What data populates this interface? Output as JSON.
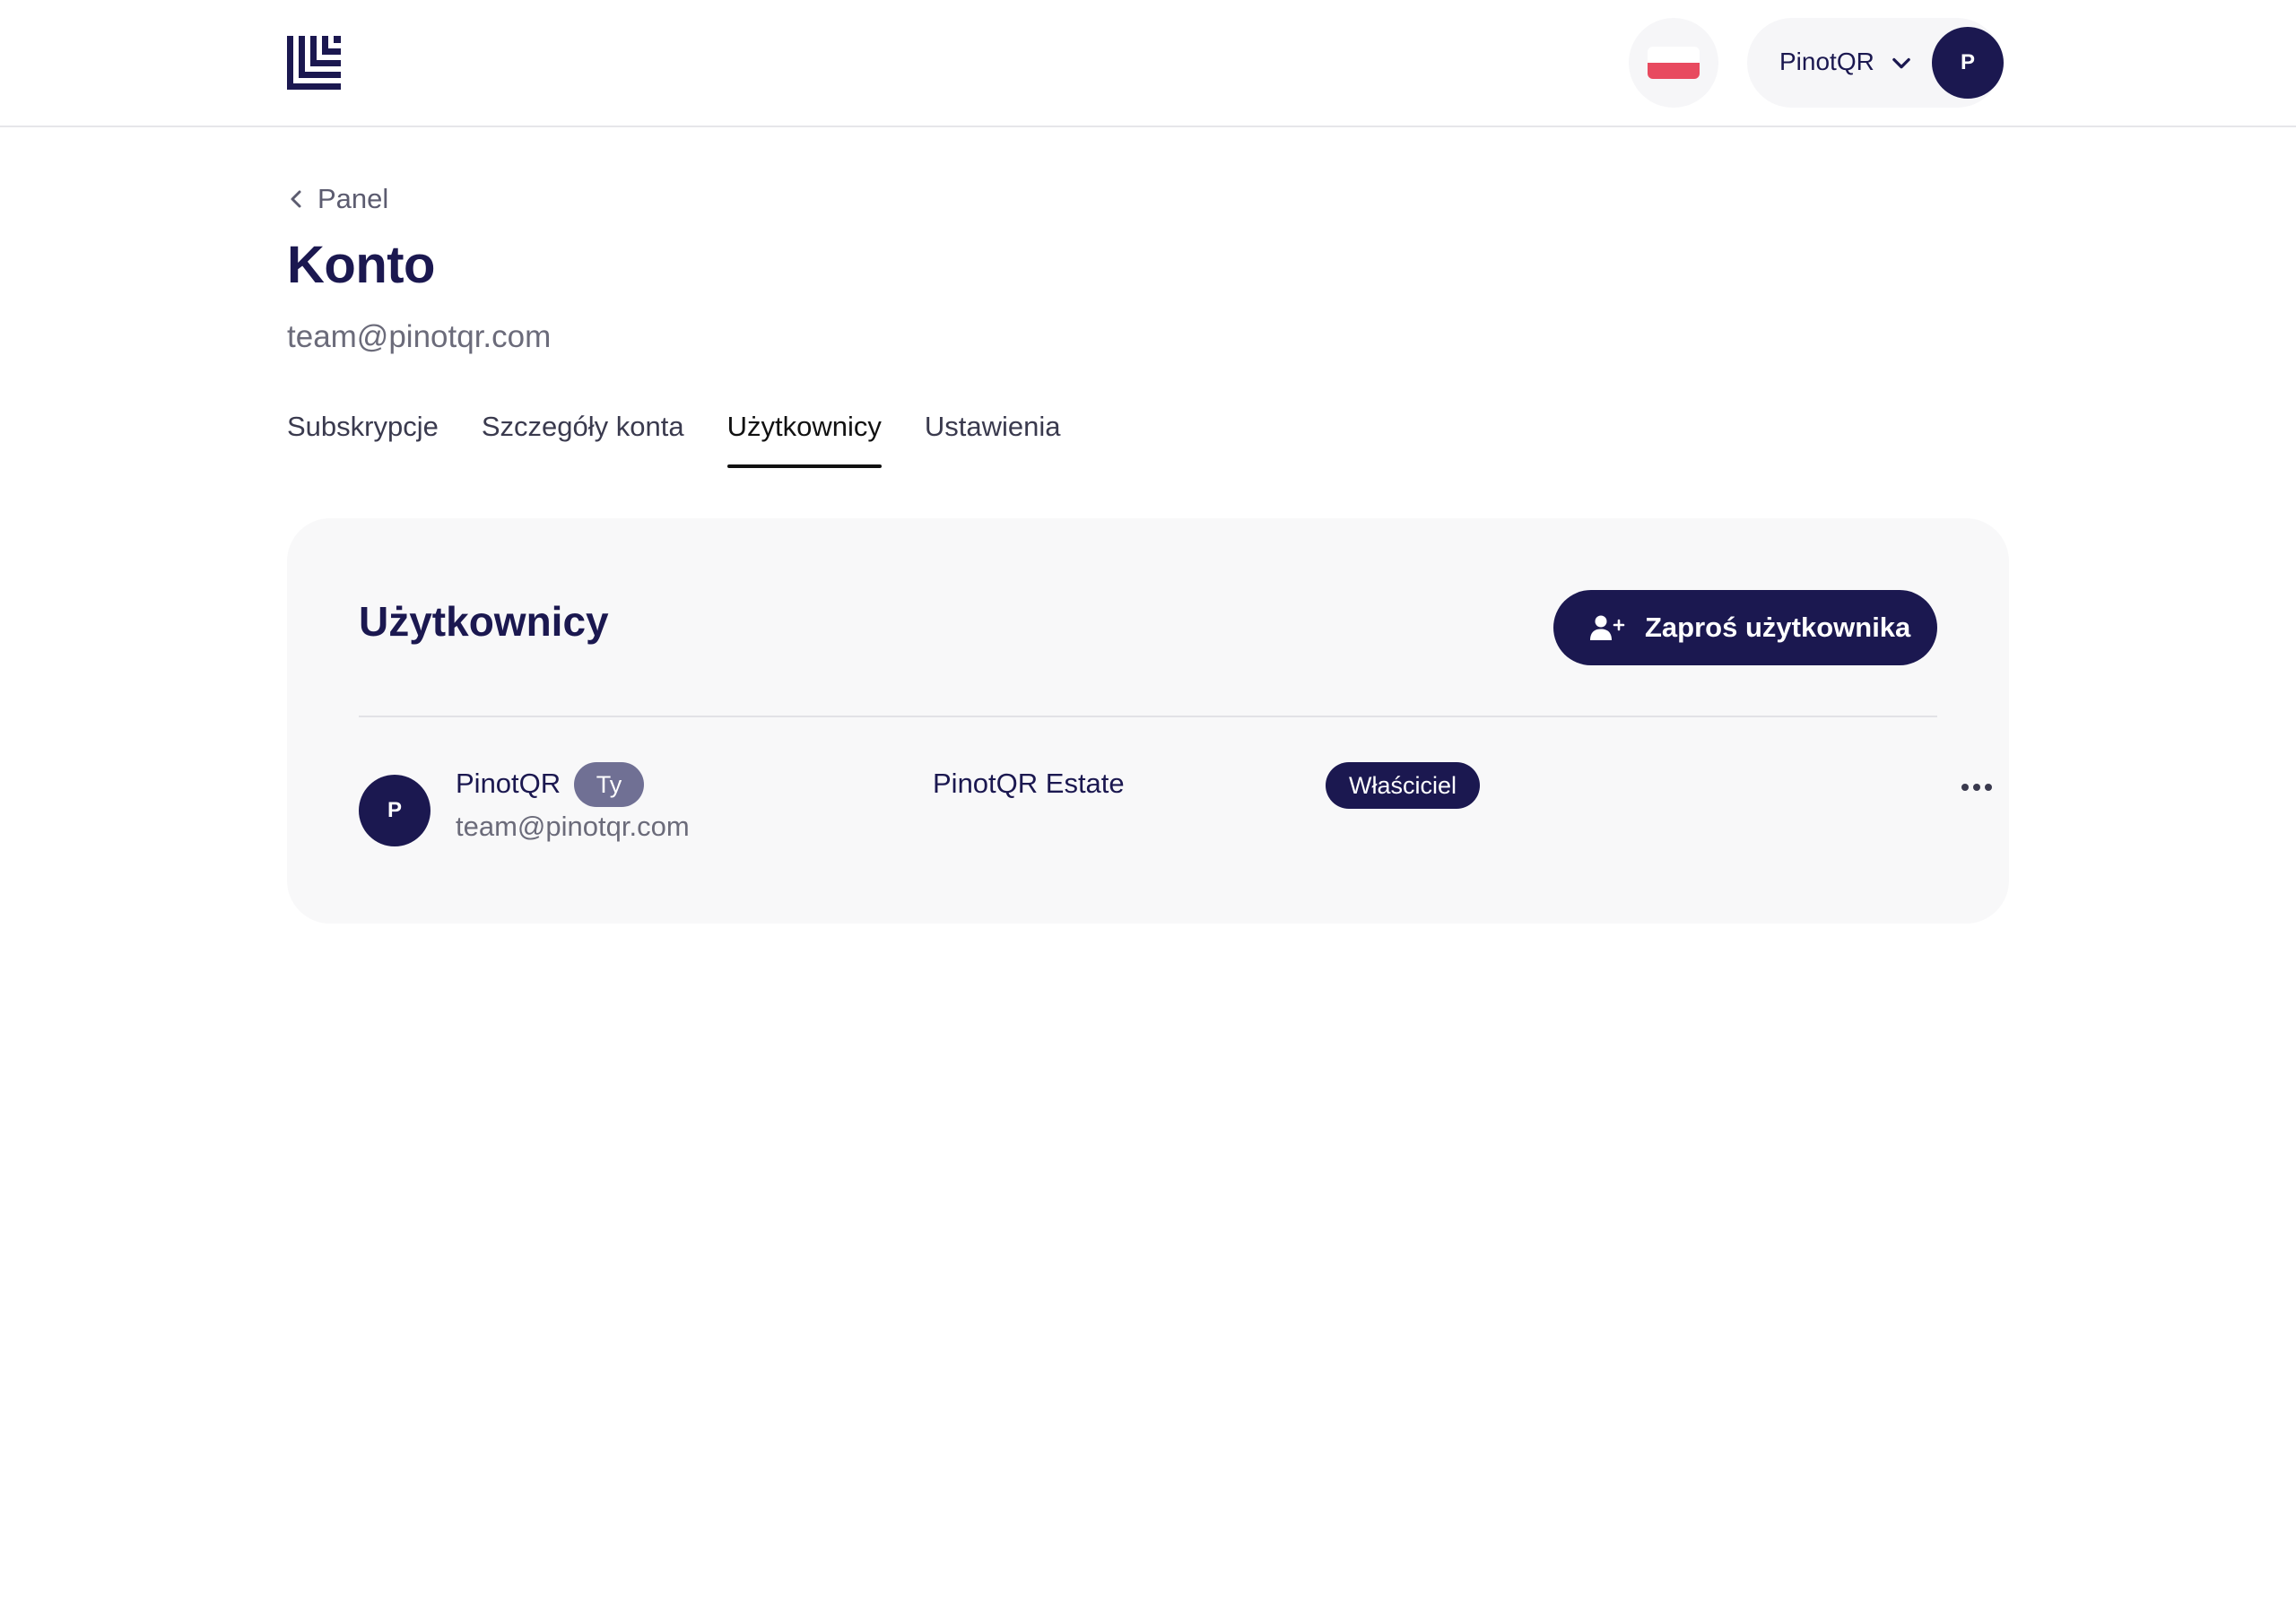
{
  "header": {
    "logo_icon": "brand-logo-icon",
    "language_flag": "poland-flag-icon",
    "account_name": "PinotQR",
    "avatar_initial": "P"
  },
  "page": {
    "back_label": "Panel",
    "title": "Konto",
    "email": "team@pinotqr.com"
  },
  "tabs": [
    {
      "label": "Subskrypcje",
      "active": false
    },
    {
      "label": "Szczegóły konta",
      "active": false
    },
    {
      "label": "Użytkownicy",
      "active": true
    },
    {
      "label": "Ustawienia",
      "active": false
    }
  ],
  "users_card": {
    "title": "Użytkownicy",
    "invite_label": "Zaproś użytkownika",
    "rows": [
      {
        "avatar_initial": "P",
        "name": "PinotQR",
        "you_badge": "Ty",
        "email": "team@pinotqr.com",
        "organization": "PinotQR Estate",
        "role": "Właściciel"
      }
    ]
  },
  "colors": {
    "brand_navy": "#1b1850",
    "badge_gray": "#707094",
    "flag_red": "#e84a5f"
  }
}
